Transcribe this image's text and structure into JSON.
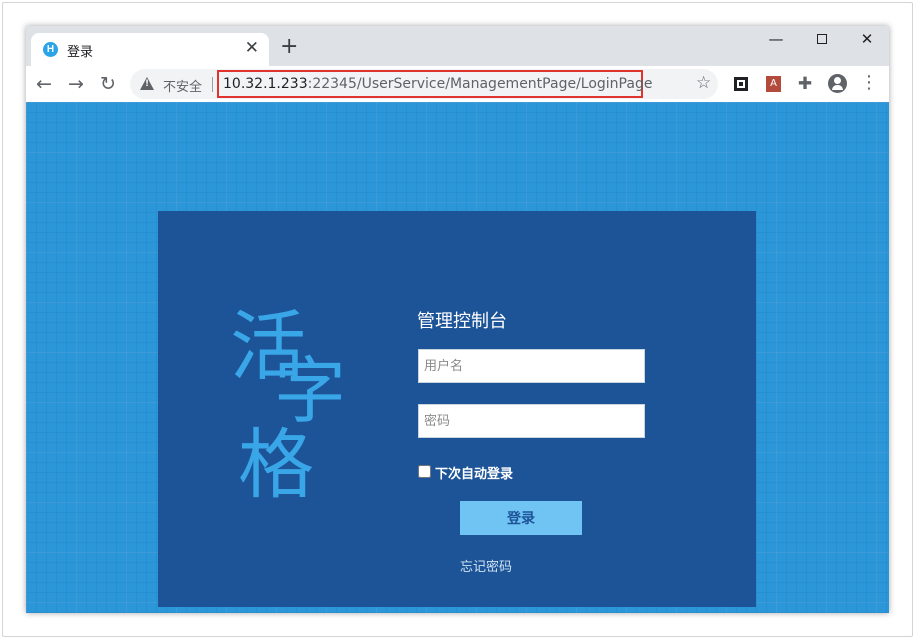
{
  "browser": {
    "tab": {
      "title": "登录",
      "favicon_glyph": "H",
      "close_glyph": "✕"
    },
    "new_tab_glyph": "+",
    "window_controls": {
      "minimize": "—",
      "close": "✕"
    },
    "toolbar": {
      "back_glyph": "←",
      "forward_glyph": "→",
      "reload_glyph": "↻",
      "security_label": "不安全",
      "url_host": "10.32.1.233",
      "url_rest": ":22345/UserService/ManagementPage/LoginPage",
      "star_glyph": "☆",
      "puzzle_glyph": "✚",
      "menu_glyph": "⋮",
      "pdf_glyph": "A"
    }
  },
  "page": {
    "logo_chars": [
      "活",
      "字",
      "格"
    ],
    "title": "管理控制台",
    "username_placeholder": "用户名",
    "password_placeholder": "密码",
    "remember_label": "下次自动登录",
    "login_button": "登录",
    "forgot_link": "忘记密码"
  },
  "colors": {
    "page_background": "#2b96d8",
    "panel_background": "#1d5498",
    "logo": "#39a6e8",
    "login_button": "#6fc4f3",
    "url_highlight": "#e0342f"
  }
}
